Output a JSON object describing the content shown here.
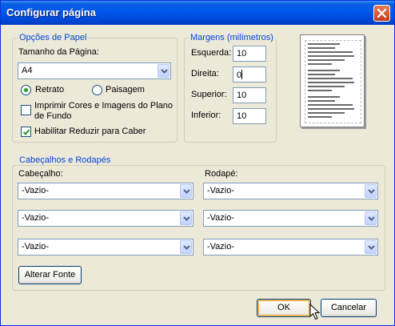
{
  "window": {
    "title": "Configurar página"
  },
  "paper_options": {
    "legend": "Opções de Papel",
    "size_label": "Tamanho da Página:",
    "size_value": "A4",
    "orientation": {
      "portrait": "Retrato",
      "landscape": "Paisagem",
      "selected": "portrait"
    },
    "print_colors_label": "Imprimir Cores e Imagens do Plano de Fundo",
    "print_colors_line1": "Imprimir Cores e Imagens do Plano",
    "print_colors_line2": "de Fundo",
    "print_colors_checked": false,
    "shrink_to_fit_label": "Habilitar Reduzir para Caber",
    "shrink_to_fit_checked": true
  },
  "margins": {
    "legend": "Margens (milímetros)",
    "left_label": "Esquerda:",
    "left_value": "10",
    "right_label": "Direita:",
    "right_value": "0",
    "top_label": "Superior:",
    "top_value": "10",
    "bottom_label": "Inferior:",
    "bottom_value": "10"
  },
  "headers_footers": {
    "legend": "Cabeçalhos e Rodapés",
    "header_label": "Cabeçalho:",
    "footer_label": "Rodapé:",
    "header_values": [
      "-Vazio-",
      "-Vazio-",
      "-Vazio-"
    ],
    "footer_values": [
      "-Vazio-",
      "-Vazio-",
      "-Vazio-"
    ],
    "change_font_label": "Alterar Fonte"
  },
  "buttons": {
    "ok": "OK",
    "cancel": "Cancelar"
  },
  "icons": {
    "close": "close-icon",
    "dropdown": "chevron-down-icon",
    "check": "checkmark-icon",
    "cursor": "mouse-pointer-icon"
  },
  "colors": {
    "title_bar": "#0058ee",
    "group_legend": "#0046d5",
    "dialog_bg": "#ece9d8",
    "close_button": "#c43a17"
  }
}
